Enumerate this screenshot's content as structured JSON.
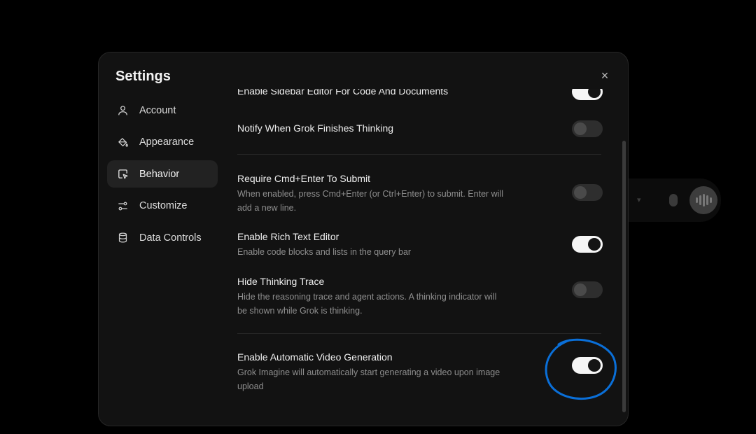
{
  "settings": {
    "title": "Settings",
    "close_glyph": "×"
  },
  "nav": {
    "items": [
      {
        "label": "Account",
        "icon": "user-icon"
      },
      {
        "label": "Appearance",
        "icon": "paint-bucket-icon"
      },
      {
        "label": "Behavior",
        "icon": "cursor-box-icon",
        "active": true
      },
      {
        "label": "Customize",
        "icon": "sliders-icon"
      },
      {
        "label": "Data Controls",
        "icon": "database-icon"
      }
    ]
  },
  "behavior": {
    "items": [
      {
        "title": "Enable Sidebar Editor For Code And Documents",
        "desc": "",
        "enabled": true
      },
      {
        "title": "Notify When Grok Finishes Thinking",
        "desc": "",
        "enabled": false
      },
      {
        "title": "Require Cmd+Enter To Submit",
        "desc": "When enabled, press Cmd+Enter (or Ctrl+Enter) to submit. Enter will add a new line.",
        "enabled": false
      },
      {
        "title": "Enable Rich Text Editor",
        "desc": "Enable code blocks and lists in the query bar",
        "enabled": true
      },
      {
        "title": "Hide Thinking Trace",
        "desc": "Hide the reasoning trace and agent actions. A thinking indicator will be shown while Grok is thinking.",
        "enabled": false
      },
      {
        "title": "Enable Automatic Video Generation",
        "desc": "Grok Imagine will automatically start generating a video upon image upload",
        "enabled": true
      }
    ]
  },
  "colors": {
    "annotation": "#0a6fd8",
    "toggle_on": "#f5f5f5",
    "toggle_off": "#2e2e2e"
  }
}
